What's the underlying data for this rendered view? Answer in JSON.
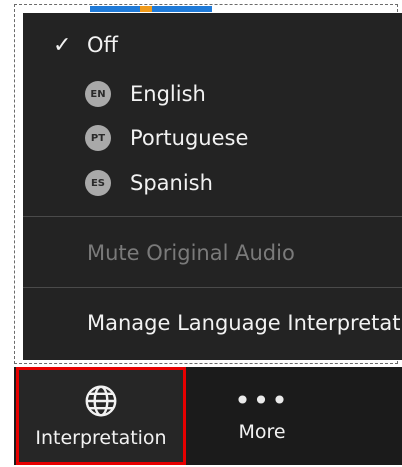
{
  "menu": {
    "items": [
      {
        "label": "Off",
        "checked": true
      },
      {
        "badge": "EN",
        "label": "English"
      },
      {
        "badge": "PT",
        "label": "Portuguese"
      },
      {
        "badge": "ES",
        "label": "Spanish"
      }
    ],
    "mute_label": "Mute Original Audio",
    "manage_label": "Manage Language Interpretation"
  },
  "toolbar": {
    "interpretation_label": "Interpretation",
    "more_label": "More",
    "more_glyph": "•••"
  },
  "colors": {
    "menu_bg": "#232323",
    "toolbar_bg": "#1b1b1b",
    "highlight_border": "#e60000",
    "badge_bg": "#a9a9a9",
    "disabled_text": "#7a7a7a",
    "accent_blue": "#1f7ad8",
    "accent_orange": "#f09a1a"
  },
  "icons": {
    "check": "checkmark-icon",
    "interpretation": "globe-icon",
    "more": "ellipsis-icon"
  }
}
